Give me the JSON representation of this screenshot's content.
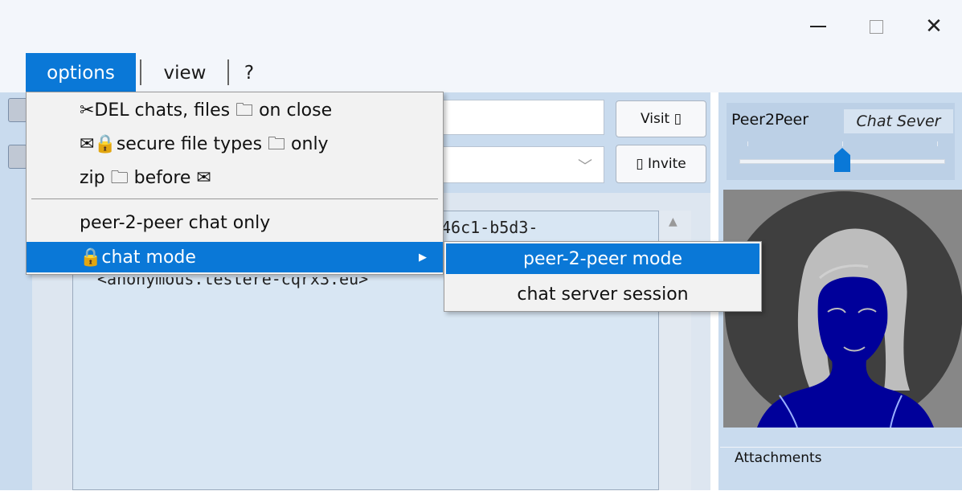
{
  "window": {
    "minimize": "minimize",
    "maximize": "maximize",
    "close_glyph": "✕"
  },
  "menubar": {
    "items": [
      {
        "label": "options",
        "active": true
      },
      {
        "label": "view",
        "active": false
      },
      {
        "label": "?",
        "active": false
      }
    ]
  },
  "toolbar": {
    "visit_label": "Visit ▯",
    "invite_label": "▯ Invite"
  },
  "chat": {
    "lines": [
      "46c1-b5d3-",
      "<anonymous.testere-cqrx3.eu>"
    ]
  },
  "mode": {
    "left_label": "Peer2Peer",
    "right_label": "Chat Sever",
    "slider_position": "middle"
  },
  "attachments": {
    "label": "Attachments"
  },
  "options_menu": {
    "items": [
      {
        "label": "✂DEL chats, files 🗀 on close"
      },
      {
        "label": "✉🔒secure file types 🗀 only"
      },
      {
        "label": "zip 🗀 before ✉"
      },
      {
        "label": "peer-2-peer chat only"
      },
      {
        "label": "🔒chat mode",
        "has_submenu": true,
        "highlighted": true
      }
    ]
  },
  "chat_mode_submenu": {
    "items": [
      {
        "label": "peer-2-peer mode",
        "highlighted": true
      },
      {
        "label": "chat server session",
        "highlighted": false
      }
    ]
  },
  "colors": {
    "accent": "#0a78d7",
    "panel": "#c9dbee",
    "avatar_fill": "#00009a"
  }
}
